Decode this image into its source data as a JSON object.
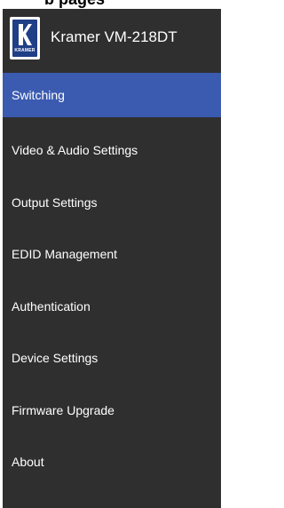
{
  "caption": {
    "text": "b pages"
  },
  "header": {
    "logo_text": "KRAMER",
    "title": "Kramer VM-218DT"
  },
  "nav": {
    "active_index": 0,
    "items": [
      {
        "label": "Switching"
      },
      {
        "label": "Video & Audio Settings"
      },
      {
        "label": "Output Settings"
      },
      {
        "label": "EDID Management"
      },
      {
        "label": "Authentication"
      },
      {
        "label": "Device Settings"
      },
      {
        "label": "Firmware Upgrade"
      },
      {
        "label": "About"
      }
    ]
  },
  "colors": {
    "panel_background": "#2f2f2f",
    "active_item": "#3b5bb0",
    "logo_blue": "#1f3f86",
    "text": "#ffffff"
  },
  "icons": {
    "logo": "kramer-logo-icon"
  }
}
